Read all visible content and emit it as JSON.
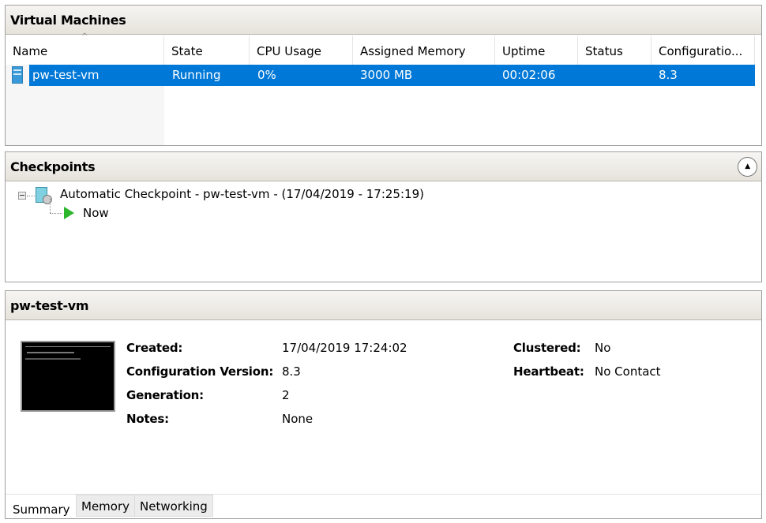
{
  "vm_panel": {
    "title": "Virtual Machines",
    "columns": [
      "Name",
      "State",
      "CPU Usage",
      "Assigned Memory",
      "Uptime",
      "Status",
      "Configuratio..."
    ],
    "rows": [
      {
        "name": "pw-test-vm",
        "state": "Running",
        "cpu": "0%",
        "memory": "3000 MB",
        "uptime": "00:02:06",
        "status": "",
        "config": "8.3"
      }
    ]
  },
  "checkpoints": {
    "title": "Checkpoints",
    "items": [
      {
        "label": "Automatic Checkpoint - pw-test-vm - (17/04/2019 - 17:25:19)"
      },
      {
        "label": "Now"
      }
    ]
  },
  "details": {
    "title": "pw-test-vm",
    "fields": [
      {
        "label": "Created:",
        "value": "17/04/2019 17:24:02"
      },
      {
        "label": "Configuration Version:",
        "value": "8.3"
      },
      {
        "label": "Generation:",
        "value": "2"
      },
      {
        "label": "Notes:",
        "value": "None"
      }
    ],
    "fields_right": [
      {
        "label": "Clustered:",
        "value": "No"
      },
      {
        "label": "Heartbeat:",
        "value": "No Contact"
      }
    ],
    "tabs": [
      "Summary",
      "Memory",
      "Networking"
    ],
    "active_tab": "Summary"
  },
  "colors": {
    "selection": "#0078d7",
    "play": "#2db52d"
  }
}
